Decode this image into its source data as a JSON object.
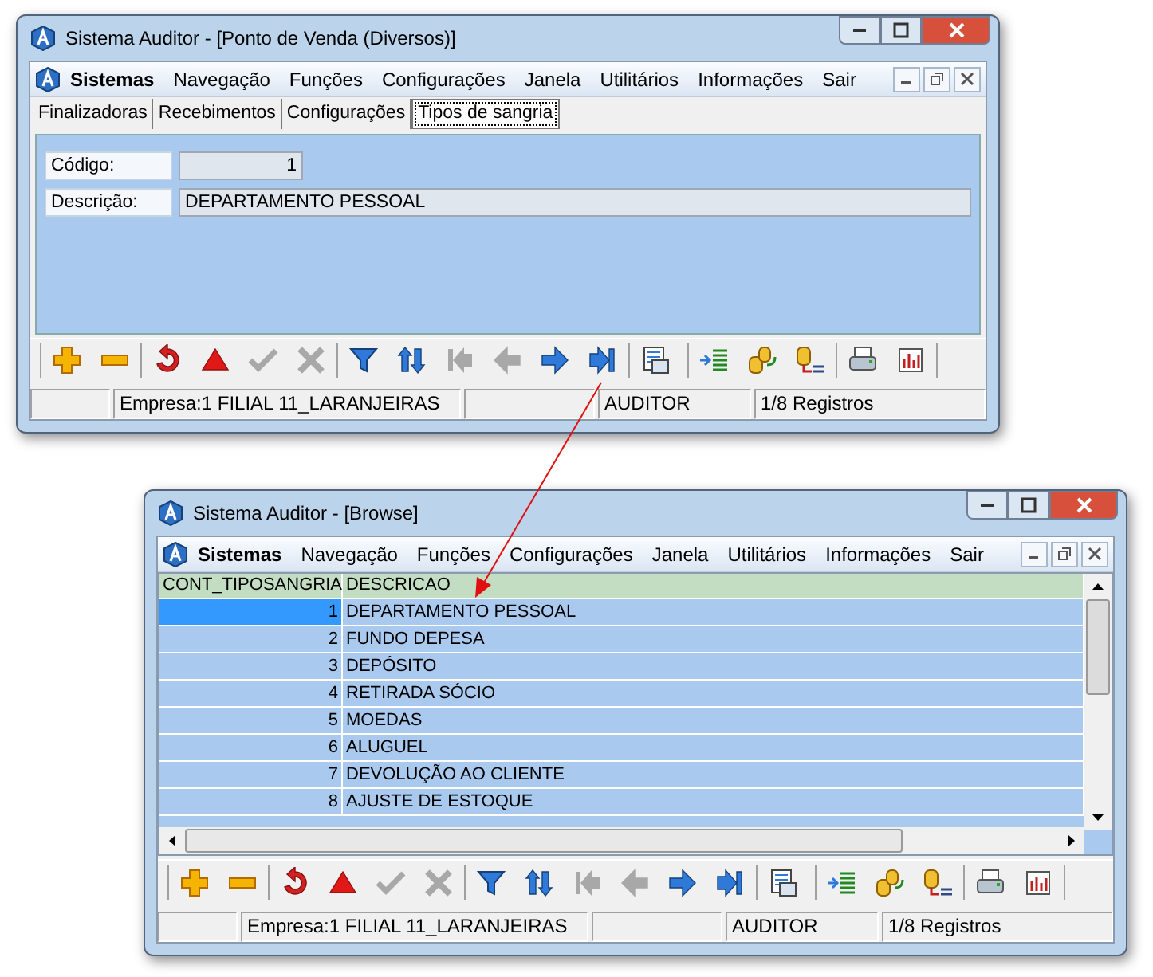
{
  "windows": [
    {
      "kind": "form",
      "title": "Sistema Auditor - [Ponto de Venda (Diversos)]",
      "menu": [
        {
          "label": "Sistemas",
          "bold": true
        },
        {
          "label": "Navegação",
          "bold": false
        },
        {
          "label": "Funções",
          "bold": false
        },
        {
          "label": "Configurações",
          "bold": false
        },
        {
          "label": "Janela",
          "bold": false
        },
        {
          "label": "Utilitários",
          "bold": false
        },
        {
          "label": "Informações",
          "bold": false
        },
        {
          "label": "Sair",
          "bold": false
        }
      ],
      "tabs": [
        {
          "label": "Finalizadoras",
          "selected": false
        },
        {
          "label": "Recebimentos",
          "selected": false
        },
        {
          "label": "Configurações",
          "selected": false
        },
        {
          "label": "Tipos de sangria",
          "selected": true
        }
      ],
      "fields": [
        {
          "label": "Código:",
          "value": "1"
        },
        {
          "label": "Descrição:",
          "value": "DEPARTAMENTO PESSOAL"
        }
      ],
      "status": [
        "Empresa:1 FILIAL 11_LARANJEIRAS",
        "AUDITOR",
        "1/8 Registros"
      ]
    },
    {
      "kind": "browse",
      "title": "Sistema Auditor - [Browse]",
      "menu": [
        {
          "label": "Sistemas",
          "bold": true
        },
        {
          "label": "Navegação",
          "bold": false
        },
        {
          "label": "Funções",
          "bold": false
        },
        {
          "label": "Configurações",
          "bold": false
        },
        {
          "label": "Janela",
          "bold": false
        },
        {
          "label": "Utilitários",
          "bold": false
        },
        {
          "label": "Informações",
          "bold": false
        },
        {
          "label": "Sair",
          "bold": false
        }
      ],
      "table": {
        "columns": [
          "CONT_TIPOSANGRIA",
          "DESCRICAO"
        ],
        "rows": [
          {
            "cells": [
              "1",
              "DEPARTAMENTO PESSOAL"
            ],
            "selected": true
          },
          {
            "cells": [
              "2",
              "FUNDO DEPESA"
            ],
            "selected": false
          },
          {
            "cells": [
              "3",
              "DEPÓSITO"
            ],
            "selected": false
          },
          {
            "cells": [
              "4",
              "RETIRADA SÓCIO"
            ],
            "selected": false
          },
          {
            "cells": [
              "5",
              "MOEDAS"
            ],
            "selected": false
          },
          {
            "cells": [
              "6",
              "ALUGUEL"
            ],
            "selected": false
          },
          {
            "cells": [
              "7",
              "DEVOLUÇÃO AO CLIENTE"
            ],
            "selected": false
          },
          {
            "cells": [
              "8",
              "AJUSTE DE ESTOQUE"
            ],
            "selected": false
          }
        ]
      },
      "status": [
        "Empresa:1 FILIAL 11_LARANJEIRAS",
        "AUDITOR",
        "1/8 Registros"
      ]
    }
  ],
  "toolbar": [
    [
      {
        "kind": "add",
        "disabled": false
      },
      {
        "kind": "remove",
        "disabled": false
      }
    ],
    [
      {
        "kind": "undo",
        "disabled": false
      },
      {
        "kind": "up",
        "disabled": false
      },
      {
        "kind": "check",
        "disabled": true
      },
      {
        "kind": "cancel",
        "disabled": true
      }
    ],
    [
      {
        "kind": "filter",
        "disabled": false
      },
      {
        "kind": "sort",
        "disabled": false
      },
      {
        "kind": "first",
        "disabled": true
      },
      {
        "kind": "prev",
        "disabled": true
      },
      {
        "kind": "next",
        "disabled": false
      },
      {
        "kind": "last",
        "disabled": false
      }
    ],
    [
      {
        "kind": "grid",
        "disabled": false
      }
    ],
    [
      {
        "kind": "import",
        "disabled": false
      },
      {
        "kind": "swap",
        "disabled": false
      },
      {
        "kind": "list",
        "disabled": false
      }
    ],
    [
      {
        "kind": "print",
        "disabled": false
      },
      {
        "kind": "chart",
        "disabled": false
      }
    ]
  ]
}
